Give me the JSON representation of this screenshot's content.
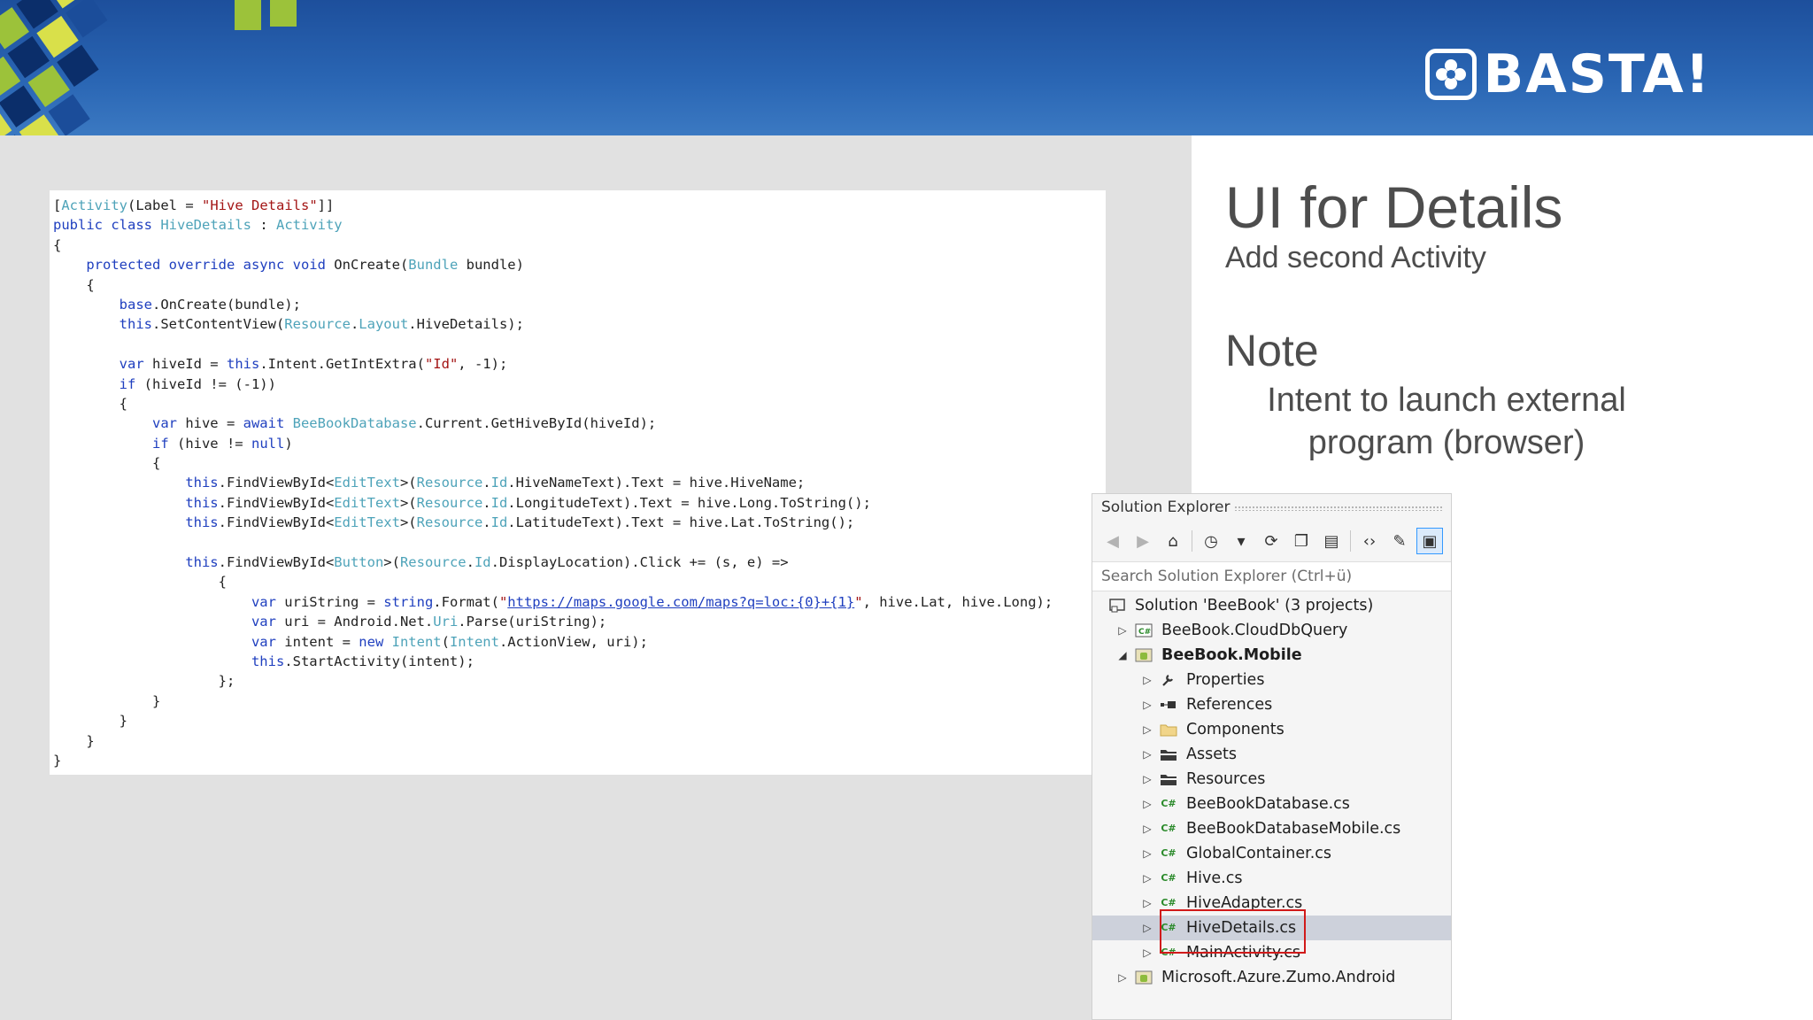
{
  "branding": {
    "logo_text": "BASTA!"
  },
  "colors": {
    "header": "#2a66b4",
    "keyword": "#1f3fbf",
    "type": "#4ea3b9",
    "string": "#a31515",
    "highlight": "#d11a1a"
  },
  "slide": {
    "title": "UI for Details",
    "subtitle": "Add second Activity",
    "note_heading": "Note",
    "note_line1": "Intent to launch external",
    "note_line2": "program (browser)"
  },
  "code_lines": [
    [
      [
        "ann",
        "["
      ],
      [
        "ty",
        "Activity"
      ],
      [
        "",
        "(Label = "
      ],
      [
        "st",
        "\"Hive Details\""
      ],
      [
        "",
        "]]"
      ]
    ],
    [
      [
        "kw",
        "public class "
      ],
      [
        "ty",
        "HiveDetails"
      ],
      [
        "",
        " : "
      ],
      [
        "ty",
        "Activity"
      ]
    ],
    [
      [
        "",
        "{"
      ]
    ],
    [
      [
        "",
        "    "
      ],
      [
        "kw",
        "protected override async void "
      ],
      [
        "",
        "OnCreate("
      ],
      [
        "ty",
        "Bundle"
      ],
      [
        "",
        " bundle)"
      ]
    ],
    [
      [
        "",
        "    {"
      ]
    ],
    [
      [
        "",
        "        "
      ],
      [
        "kw",
        "base"
      ],
      [
        "",
        ".OnCreate(bundle);"
      ]
    ],
    [
      [
        "",
        "        "
      ],
      [
        "kw",
        "this"
      ],
      [
        "",
        ".SetContentView("
      ],
      [
        "ty",
        "Resource"
      ],
      [
        "",
        "."
      ],
      [
        "ty",
        "Layout"
      ],
      [
        "",
        ".HiveDetails);"
      ]
    ],
    [
      [
        "",
        ""
      ]
    ],
    [
      [
        "",
        "        "
      ],
      [
        "kw",
        "var "
      ],
      [
        "",
        "hiveId = "
      ],
      [
        "kw",
        "this"
      ],
      [
        "",
        ".Intent.GetIntExtra("
      ],
      [
        "st",
        "\"Id\""
      ],
      [
        "",
        ", -1);"
      ]
    ],
    [
      [
        "",
        "        "
      ],
      [
        "kw",
        "if "
      ],
      [
        "",
        "(hiveId != (-1))"
      ]
    ],
    [
      [
        "",
        "        {"
      ]
    ],
    [
      [
        "",
        "            "
      ],
      [
        "kw",
        "var "
      ],
      [
        "",
        "hive = "
      ],
      [
        "kw",
        "await "
      ],
      [
        "ty",
        "BeeBookDatabase"
      ],
      [
        "",
        ".Current.GetHiveById(hiveId);"
      ]
    ],
    [
      [
        "",
        "            "
      ],
      [
        "kw",
        "if "
      ],
      [
        "",
        "(hive != "
      ],
      [
        "kw",
        "null"
      ],
      [
        "",
        ")"
      ]
    ],
    [
      [
        "",
        "            {"
      ]
    ],
    [
      [
        "",
        "                "
      ],
      [
        "kw",
        "this"
      ],
      [
        "",
        ".FindViewById<"
      ],
      [
        "ty",
        "EditText"
      ],
      [
        "",
        ">("
      ],
      [
        "ty",
        "Resource"
      ],
      [
        "",
        "."
      ],
      [
        "ty",
        "Id"
      ],
      [
        "",
        ".HiveNameText).Text = hive.HiveName;"
      ]
    ],
    [
      [
        "",
        "                "
      ],
      [
        "kw",
        "this"
      ],
      [
        "",
        ".FindViewById<"
      ],
      [
        "ty",
        "EditText"
      ],
      [
        "",
        ">("
      ],
      [
        "ty",
        "Resource"
      ],
      [
        "",
        "."
      ],
      [
        "ty",
        "Id"
      ],
      [
        "",
        ".LongitudeText).Text = hive.Long.ToString();"
      ]
    ],
    [
      [
        "",
        "                "
      ],
      [
        "kw",
        "this"
      ],
      [
        "",
        ".FindViewById<"
      ],
      [
        "ty",
        "EditText"
      ],
      [
        "",
        ">("
      ],
      [
        "ty",
        "Resource"
      ],
      [
        "",
        "."
      ],
      [
        "ty",
        "Id"
      ],
      [
        "",
        ".LatitudeText).Text = hive.Lat.ToString();"
      ]
    ],
    [
      [
        "",
        ""
      ]
    ],
    [
      [
        "",
        "                "
      ],
      [
        "kw",
        "this"
      ],
      [
        "",
        ".FindViewById<"
      ],
      [
        "ty",
        "Button"
      ],
      [
        "",
        ">("
      ],
      [
        "ty",
        "Resource"
      ],
      [
        "",
        "."
      ],
      [
        "ty",
        "Id"
      ],
      [
        "",
        ".DisplayLocation).Click += (s, e) =>"
      ]
    ],
    [
      [
        "",
        "                    {"
      ]
    ],
    [
      [
        "",
        "                        "
      ],
      [
        "kw",
        "var "
      ],
      [
        "",
        "uriString = "
      ],
      [
        "kw",
        "string"
      ],
      [
        "",
        ".Format("
      ],
      [
        "st",
        "\""
      ],
      [
        "url",
        "https://maps.google.com/maps?q=loc:{0}+{1}"
      ],
      [
        "st",
        "\""
      ],
      [
        "",
        ", hive.Lat, hive.Long);"
      ]
    ],
    [
      [
        "",
        "                        "
      ],
      [
        "kw",
        "var "
      ],
      [
        "",
        "uri = Android.Net."
      ],
      [
        "ty",
        "Uri"
      ],
      [
        "",
        ".Parse(uriString);"
      ]
    ],
    [
      [
        "",
        "                        "
      ],
      [
        "kw",
        "var "
      ],
      [
        "",
        "intent = "
      ],
      [
        "kw",
        "new "
      ],
      [
        "ty",
        "Intent"
      ],
      [
        "",
        "("
      ],
      [
        "ty",
        "Intent"
      ],
      [
        "",
        ".ActionView, uri);"
      ]
    ],
    [
      [
        "",
        "                        "
      ],
      [
        "kw",
        "this"
      ],
      [
        "",
        ".StartActivity(intent);"
      ]
    ],
    [
      [
        "",
        "                    };"
      ]
    ],
    [
      [
        "",
        "            }"
      ]
    ],
    [
      [
        "",
        "        }"
      ]
    ],
    [
      [
        "",
        "    }"
      ]
    ],
    [
      [
        "",
        "}"
      ]
    ]
  ],
  "solution_explorer": {
    "title": "Solution Explorer",
    "search_placeholder": "Search Solution Explorer (Ctrl+ü)",
    "toolbar": [
      {
        "icon": "back-icon",
        "glyph": "◀",
        "dim": true
      },
      {
        "icon": "forward-icon",
        "glyph": "▶",
        "dim": true
      },
      {
        "icon": "home-icon",
        "glyph": "⌂"
      },
      {
        "sep": true
      },
      {
        "icon": "history-icon",
        "glyph": "◷"
      },
      {
        "icon": "dropdown-icon",
        "glyph": "▾"
      },
      {
        "icon": "sync-icon",
        "glyph": "⟳"
      },
      {
        "icon": "collapse-all-icon",
        "glyph": "❐"
      },
      {
        "icon": "show-all-files-icon",
        "glyph": "▤"
      },
      {
        "sep": true
      },
      {
        "icon": "view-code-icon",
        "glyph": "‹›"
      },
      {
        "icon": "properties-icon",
        "glyph": "✎"
      },
      {
        "icon": "preview-icon",
        "glyph": "▣",
        "active": true
      }
    ],
    "items": [
      {
        "label": "Solution 'BeeBook' (3 projects)",
        "icon": "solution-icon",
        "level": 0,
        "arrow": ""
      },
      {
        "label": "BeeBook.CloudDbQuery",
        "icon": "csharp-project-icon",
        "level": 1,
        "arrow": "▷"
      },
      {
        "label": "BeeBook.Mobile",
        "icon": "android-project-icon",
        "level": 1,
        "arrow": "◢",
        "bold": true
      },
      {
        "label": "Properties",
        "icon": "wrench-icon",
        "level": 2,
        "arrow": "▷"
      },
      {
        "label": "References",
        "icon": "references-icon",
        "level": 2,
        "arrow": "▷"
      },
      {
        "label": "Components",
        "icon": "folder-icon",
        "level": 2,
        "arrow": "▷"
      },
      {
        "label": "Assets",
        "icon": "folder-dark-icon",
        "level": 2,
        "arrow": "▷"
      },
      {
        "label": "Resources",
        "icon": "folder-dark-icon",
        "level": 2,
        "arrow": "▷"
      },
      {
        "label": "BeeBookDatabase.cs",
        "icon": "csharp-file-icon",
        "level": 2,
        "arrow": "▷"
      },
      {
        "label": "BeeBookDatabaseMobile.cs",
        "icon": "csharp-file-icon",
        "level": 2,
        "arrow": "▷"
      },
      {
        "label": "GlobalContainer.cs",
        "icon": "csharp-file-icon",
        "level": 2,
        "arrow": "▷"
      },
      {
        "label": "Hive.cs",
        "icon": "csharp-file-icon",
        "level": 2,
        "arrow": "▷"
      },
      {
        "label": "HiveAdapter.cs",
        "icon": "csharp-file-icon",
        "level": 2,
        "arrow": "▷"
      },
      {
        "label": "HiveDetails.cs",
        "icon": "csharp-file-icon",
        "level": 2,
        "arrow": "▷",
        "selected": true
      },
      {
        "label": "MainActivity.cs",
        "icon": "csharp-file-icon",
        "level": 2,
        "arrow": "▷"
      },
      {
        "label": "Microsoft.Azure.Zumo.Android",
        "icon": "android-project-icon",
        "level": 1,
        "arrow": "▷"
      }
    ]
  }
}
